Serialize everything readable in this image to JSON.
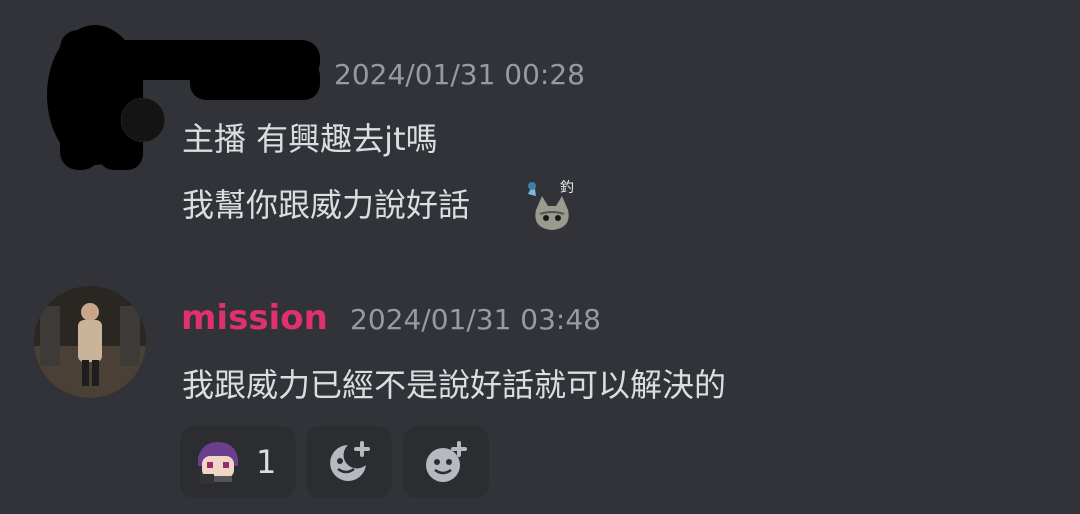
{
  "messages": [
    {
      "username": "",
      "timestamp": "2024/01/31 00:28",
      "lines": [
        "主播 有興趣去jt嗎",
        "我幫你跟威力說好話"
      ],
      "emoji": "cat-fishing-emoji"
    },
    {
      "username": "mission",
      "username_color": "#e0306e",
      "timestamp": "2024/01/31 03:48",
      "lines": [
        "我跟威力已經不是說好話就可以解決的"
      ]
    }
  ],
  "reactions": [
    {
      "icon": "anime-avatar-emoji",
      "count": "1"
    },
    {
      "icon": "add-reaction-icon"
    },
    {
      "icon": "add-super-reaction-icon"
    }
  ],
  "colors": {
    "background": "#313338",
    "reaction_bg": "#2b2d31",
    "timestamp": "#949ba4",
    "text": "#dbdee1"
  }
}
